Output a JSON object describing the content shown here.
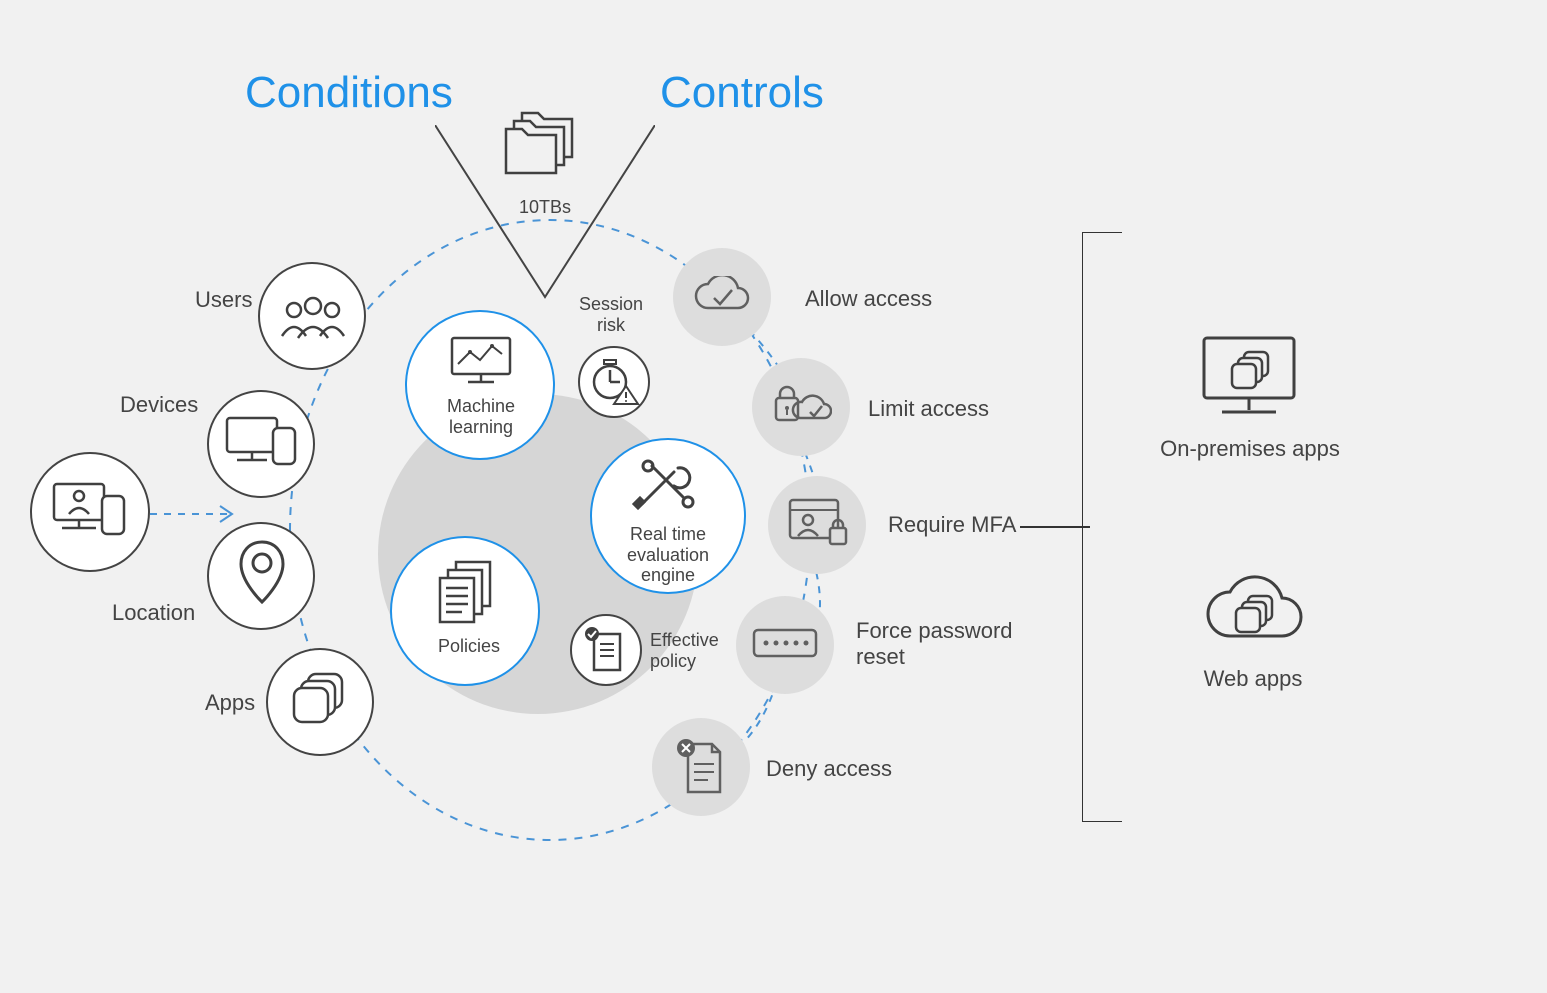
{
  "headings": {
    "conditions": "Conditions",
    "controls": "Controls"
  },
  "sublabels": {
    "tenTBs": "10TBs"
  },
  "conditions": {
    "users": "Users",
    "devices": "Devices",
    "location": "Location",
    "apps": "Apps"
  },
  "center": {
    "ml": "Machine learning",
    "policies": "Policies",
    "session": "Session risk",
    "effective": "Effective policy",
    "engine": "Real time evaluation engine"
  },
  "controls": {
    "allow": "Allow access",
    "limit": "Limit access",
    "mfa": "Require MFA",
    "reset": "Force password reset",
    "deny": "Deny access"
  },
  "outputs": {
    "onprem": "On-premises apps",
    "web": "Web apps"
  }
}
